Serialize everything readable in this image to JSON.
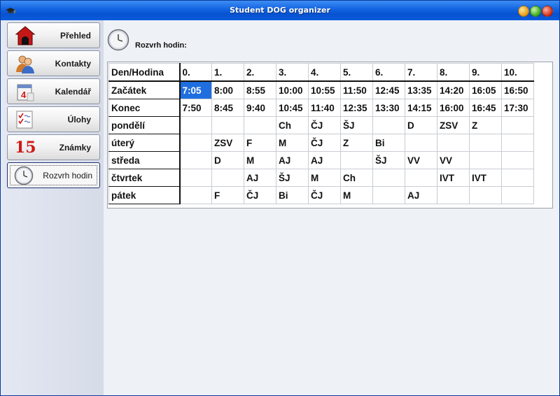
{
  "window": {
    "title": "Student DOG organizer"
  },
  "sidebar": {
    "items": [
      {
        "label": "Přehled",
        "icon": "doghouse-icon"
      },
      {
        "label": "Kontakty",
        "icon": "people-icon"
      },
      {
        "label": "Kalendář",
        "icon": "calendar-icon"
      },
      {
        "label": "Úlohy",
        "icon": "checklist-icon"
      },
      {
        "label": "Známky",
        "icon": "grade-icon",
        "icon_text": "15"
      },
      {
        "label": "Rozvrh hodin",
        "icon": "clock-icon",
        "active": true
      }
    ]
  },
  "page": {
    "title": "Rozvrh hodin:"
  },
  "schedule": {
    "columns": [
      "Den/Hodina",
      "0.",
      "1.",
      "2.",
      "3.",
      "4.",
      "5.",
      "6.",
      "7.",
      "8.",
      "9.",
      "10."
    ],
    "rows": [
      {
        "label": "Začátek",
        "cells": [
          "7:05",
          "8:00",
          "8:55",
          "10:00",
          "10:55",
          "11:50",
          "12:45",
          "13:35",
          "14:20",
          "16:05",
          "16:50"
        ]
      },
      {
        "label": "Konec",
        "cells": [
          "7:50",
          "8:45",
          "9:40",
          "10:45",
          "11:40",
          "12:35",
          "13:30",
          "14:15",
          "16:00",
          "16:45",
          "17:30"
        ]
      },
      {
        "label": "pondělí",
        "cells": [
          "",
          "",
          "",
          "Ch",
          "ČJ",
          "ŠJ",
          "",
          "D",
          "ZSV",
          "Z",
          ""
        ]
      },
      {
        "label": "úterý",
        "cells": [
          "",
          "ZSV",
          "F",
          "M",
          "ČJ",
          "Z",
          "Bi",
          "",
          "",
          "",
          ""
        ]
      },
      {
        "label": "středa",
        "cells": [
          "",
          "D",
          "M",
          "AJ",
          "AJ",
          "",
          "ŠJ",
          "VV",
          "VV",
          "",
          ""
        ]
      },
      {
        "label": "čtvrtek",
        "cells": [
          "",
          "",
          "AJ",
          "ŠJ",
          "M",
          "Ch",
          "",
          "",
          "IVT",
          "IVT",
          ""
        ]
      },
      {
        "label": "pátek",
        "cells": [
          "",
          "F",
          "ČJ",
          "Bi",
          "ČJ",
          "M",
          "",
          "AJ",
          "",
          "",
          ""
        ]
      }
    ],
    "selected_cell": "7:05"
  },
  "colors": {
    "titlebar": "#1162e0",
    "selection": "#1f6ee0",
    "grade_red": "#d01818"
  }
}
